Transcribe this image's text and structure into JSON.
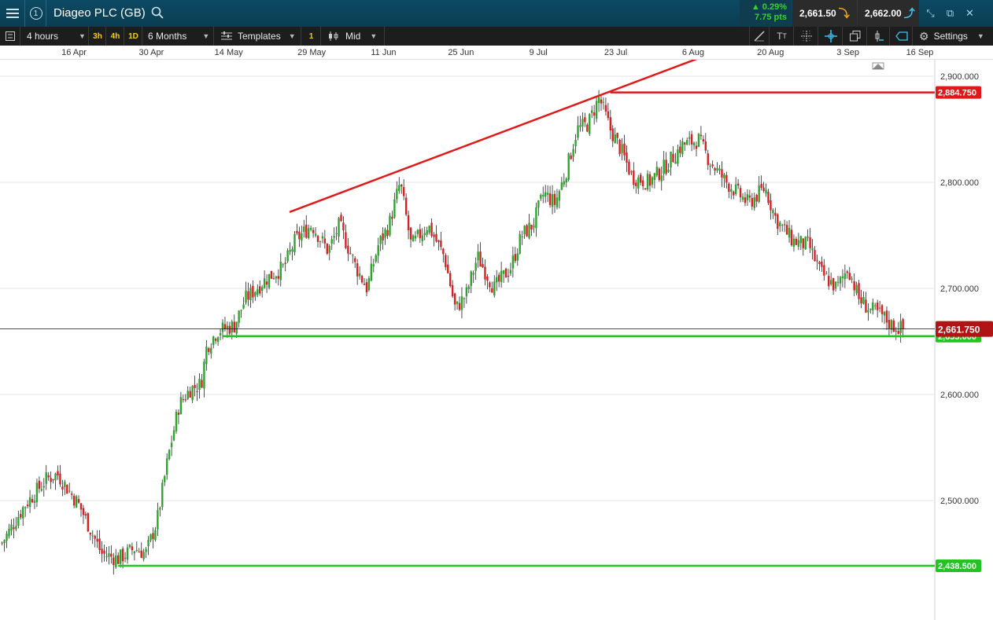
{
  "header": {
    "instrument": "Diageo PLC (GB)",
    "info_label": "1",
    "change_pct": "▲ 0.29%",
    "change_pts": "7.75 pts",
    "sell_price": "2,661.50",
    "buy_price": "2,662.00",
    "colors": {
      "up": "#38d12a",
      "sell_arrow": "#f0a028",
      "buy_arrow": "#3cc3f0",
      "bar": "#0c4a63"
    }
  },
  "toolbar": {
    "interval": "4 hours",
    "quick_3h": "3h",
    "quick_4h": "4h",
    "quick_1d": "1D",
    "range": "6 Months",
    "templates": "Templates",
    "layer_badge": "1",
    "price_mode": "Mid",
    "settings": "Settings"
  },
  "icons": [
    "menu-icon",
    "info-icon",
    "search-icon",
    "minimize-icon",
    "popout-icon",
    "close-icon",
    "draw-line-icon",
    "text-icon",
    "crosshair-icon",
    "snap-icon",
    "layers-icon",
    "indicator-icon",
    "label-icon",
    "gear-icon",
    "alert-marker-icon"
  ],
  "x_axis": [
    "16 Apr",
    "30 Apr",
    "14 May",
    "29 May",
    "11 Jun",
    "25 Jun",
    "9 Jul",
    "23 Jul",
    "6 Aug",
    "20 Aug",
    "3 Sep",
    "16 Sep"
  ],
  "chart_data": {
    "type": "candlestick",
    "instrument": "Diageo PLC (GB)",
    "interval": "4 hours",
    "range": "6 Months",
    "y_ticks": [
      2900,
      2800,
      2700,
      2600,
      2500
    ],
    "y_tick_labels": [
      "2,900.000",
      "2,800.000",
      "2,700.000",
      "2,600.000",
      "2,500.000"
    ],
    "ylim": [
      2420,
      2920
    ],
    "current_price": 2661.75,
    "current_price_label": "2,661.750",
    "horizontal_lines": [
      {
        "value": 2884.75,
        "label": "2,884.750",
        "color": "#e01818"
      },
      {
        "value": 2655.0,
        "label": "2,655.000",
        "color": "#22c422"
      },
      {
        "value": 2438.5,
        "label": "2,438.500",
        "color": "#22c422"
      }
    ],
    "trendline": {
      "from": {
        "x": "25 May",
        "y": 2772
      },
      "to": {
        "x": "7 Aug",
        "y": 2917
      },
      "color": "#e01818"
    },
    "close_path": [
      [
        "3 Apr",
        2460
      ],
      [
        "7 Apr",
        2495
      ],
      [
        "11 Apr",
        2520
      ],
      [
        "13 Apr",
        2525
      ],
      [
        "17 Apr",
        2495
      ],
      [
        "21 Apr",
        2450
      ],
      [
        "24 Apr",
        2445
      ],
      [
        "27 Apr",
        2455
      ],
      [
        "29 Apr",
        2450
      ],
      [
        "1 May",
        2480
      ],
      [
        "3 May",
        2540
      ],
      [
        "5 May",
        2590
      ],
      [
        "7 May",
        2605
      ],
      [
        "9 May",
        2610
      ],
      [
        "10 May",
        2645
      ],
      [
        "12 May",
        2660
      ],
      [
        "15 May",
        2665
      ],
      [
        "17 May",
        2690
      ],
      [
        "21 May",
        2710
      ],
      [
        "24 May",
        2720
      ],
      [
        "26 May",
        2745
      ],
      [
        "29 May",
        2760
      ],
      [
        "1 Jun",
        2735
      ],
      [
        "3 Jun",
        2760
      ],
      [
        "6 Jun",
        2720
      ],
      [
        "8 Jun",
        2700
      ],
      [
        "10 Jun",
        2740
      ],
      [
        "12 Jun",
        2760
      ],
      [
        "14 Jun",
        2800
      ],
      [
        "16 Jun",
        2740
      ],
      [
        "19 Jun",
        2760
      ],
      [
        "22 Jun",
        2730
      ],
      [
        "24 Jun",
        2680
      ],
      [
        "26 Jun",
        2695
      ],
      [
        "28 Jun",
        2730
      ],
      [
        "1 Jul",
        2700
      ],
      [
        "4 Jul",
        2720
      ],
      [
        "6 Jul",
        2750
      ],
      [
        "8 Jul",
        2760
      ],
      [
        "10 Jul",
        2790
      ],
      [
        "12 Jul",
        2780
      ],
      [
        "14 Jul",
        2810
      ],
      [
        "16 Jul",
        2850
      ],
      [
        "18 Jul",
        2855
      ],
      [
        "20 Jul",
        2880
      ],
      [
        "22 Jul",
        2850
      ],
      [
        "24 Jul",
        2830
      ],
      [
        "26 Jul",
        2805
      ],
      [
        "29 Jul",
        2800
      ],
      [
        "1 Aug",
        2815
      ],
      [
        "4 Aug",
        2835
      ],
      [
        "7 Aug",
        2840
      ],
      [
        "9 Aug",
        2820
      ],
      [
        "12 Aug",
        2800
      ],
      [
        "14 Aug",
        2790
      ],
      [
        "16 Aug",
        2780
      ],
      [
        "19 Aug",
        2795
      ],
      [
        "21 Aug",
        2765
      ],
      [
        "24 Aug",
        2745
      ],
      [
        "27 Aug",
        2740
      ],
      [
        "29 Aug",
        2715
      ],
      [
        "1 Sep",
        2700
      ],
      [
        "3 Sep",
        2720
      ],
      [
        "5 Sep",
        2690
      ],
      [
        "7 Sep",
        2680
      ],
      [
        "9 Sep",
        2675
      ],
      [
        "11 Sep",
        2665
      ],
      [
        "13 Sep",
        2661.75
      ]
    ]
  }
}
